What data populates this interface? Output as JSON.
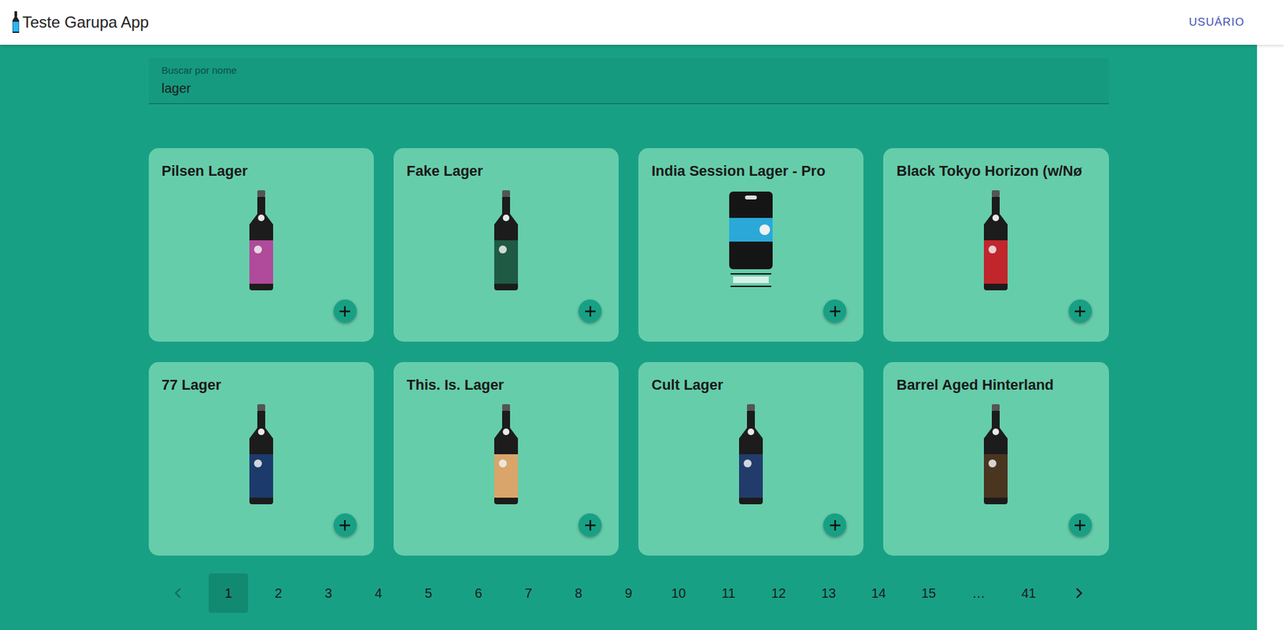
{
  "header": {
    "title": "Teste Garupa App",
    "user_button": "USUÁRIO"
  },
  "search": {
    "label": "Buscar por nome",
    "value": "lager"
  },
  "cards": [
    {
      "name": "Pilsen Lager",
      "kind": "bottle",
      "color": "#b04a9a"
    },
    {
      "name": "Fake Lager",
      "kind": "bottle",
      "color": "#1f5a45"
    },
    {
      "name": "India Session Lager - Pro",
      "kind": "keg",
      "color": "#2aa9d9"
    },
    {
      "name": "Black Tokyo Horizon (w/Nø",
      "kind": "bottle",
      "color": "#c0262c"
    },
    {
      "name": "77 Lager",
      "kind": "bottle",
      "color": "#1c3a6b"
    },
    {
      "name": "This. Is. Lager",
      "kind": "bottle",
      "color": "#d9a56b"
    },
    {
      "name": "Cult Lager",
      "kind": "bottle",
      "color": "#213c6b"
    },
    {
      "name": "Barrel Aged Hinterland",
      "kind": "bottle",
      "color": "#4a3520"
    }
  ],
  "pagination": {
    "prev": {
      "disabled": true
    },
    "items": [
      {
        "label": "1",
        "selected": true
      },
      {
        "label": "2",
        "selected": false
      },
      {
        "label": "3",
        "selected": false
      },
      {
        "label": "4",
        "selected": false
      },
      {
        "label": "5",
        "selected": false
      },
      {
        "label": "6",
        "selected": false
      },
      {
        "label": "7",
        "selected": false
      },
      {
        "label": "8",
        "selected": false
      },
      {
        "label": "9",
        "selected": false
      },
      {
        "label": "10",
        "selected": false
      },
      {
        "label": "11",
        "selected": false
      },
      {
        "label": "12",
        "selected": false
      },
      {
        "label": "13",
        "selected": false
      },
      {
        "label": "14",
        "selected": false
      },
      {
        "label": "15",
        "selected": false
      },
      {
        "label": "…",
        "selected": false
      },
      {
        "label": "41",
        "selected": false
      }
    ],
    "next": {
      "disabled": false
    }
  }
}
